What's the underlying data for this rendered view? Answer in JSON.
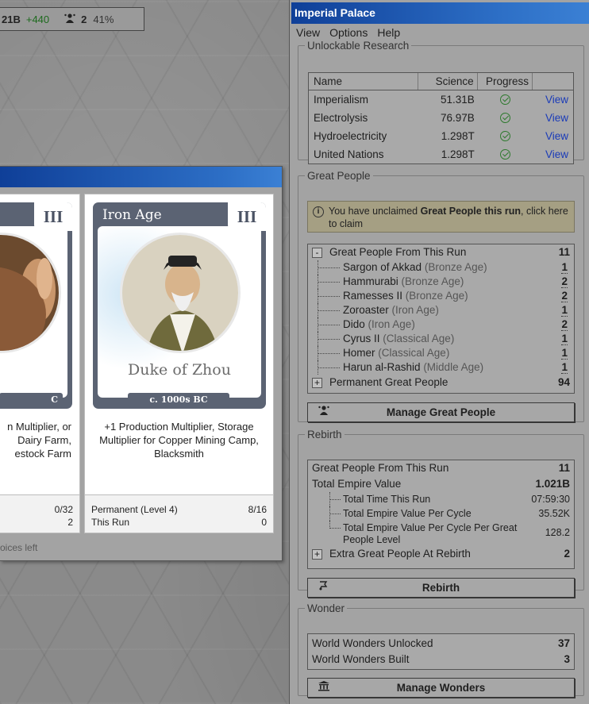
{
  "topbar": {
    "cash": "21B",
    "cash_gain": "+440",
    "great_people_icon": "great-person-icon",
    "great_people": "2",
    "percent": "41%"
  },
  "card": {
    "era": "Iron Age",
    "tier": "III",
    "name": "Duke of Zhou",
    "date": "c. 1000s BC",
    "description": "+1 Production Multiplier, Storage Multiplier for Copper Mining Camp, Blacksmith",
    "stats": {
      "permanent_label": "Permanent (Level 4)",
      "permanent_value": "8/16",
      "run_label": "This Run",
      "run_value": "0"
    }
  },
  "card_partial": {
    "tier": "III",
    "name_fragment": "",
    "date_fragment": "C",
    "description": "n Multiplier, or Dairy Farm, estock Farm",
    "stats_value1": "0/32",
    "stats_value2": "2"
  },
  "modal_footer": "oices left",
  "panel": {
    "title": "Imperial Palace",
    "menu": [
      "View",
      "Options",
      "Help"
    ],
    "research": {
      "legend": "Unlockable Research",
      "columns": [
        "Name",
        "Science",
        "Progress",
        ""
      ],
      "rows": [
        {
          "name": "Imperialism",
          "science": "51.31B",
          "view": "View"
        },
        {
          "name": "Electrolysis",
          "science": "76.97B",
          "view": "View"
        },
        {
          "name": "Hydroelectricity",
          "science": "1.298T",
          "view": "View"
        },
        {
          "name": "United Nations",
          "science": "1.298T",
          "view": "View"
        }
      ]
    },
    "great_people": {
      "legend": "Great People",
      "notice_prefix": "You have unclaimed ",
      "notice_bold": "Great People this run",
      "notice_suffix": ", click here to claim",
      "this_run_label": "Great People From This Run",
      "this_run_count": "11",
      "this_run_toggle": "-",
      "people": [
        {
          "name": "Sargon of Akkad",
          "era": "(Bronze Age)",
          "count": "1"
        },
        {
          "name": "Hammurabi",
          "era": "(Bronze Age)",
          "count": "2"
        },
        {
          "name": "Ramesses II",
          "era": "(Bronze Age)",
          "count": "2"
        },
        {
          "name": "Zoroaster",
          "era": "(Iron Age)",
          "count": "1"
        },
        {
          "name": "Dido",
          "era": "(Iron Age)",
          "count": "2"
        },
        {
          "name": "Cyrus II",
          "era": "(Classical Age)",
          "count": "1"
        },
        {
          "name": "Homer",
          "era": "(Classical Age)",
          "count": "1"
        },
        {
          "name": "Harun al-Rashid",
          "era": "(Middle Age)",
          "count": "1"
        }
      ],
      "permanent_label": "Permanent Great People",
      "permanent_count": "94",
      "permanent_toggle": "+",
      "manage_button": "Manage Great People"
    },
    "rebirth": {
      "legend": "Rebirth",
      "rows": {
        "gp_from_run_label": "Great People From This Run",
        "gp_from_run_value": "11",
        "empire_value_label": "Total Empire Value",
        "empire_value": "1.021B",
        "time_label": "Total Time This Run",
        "time_value": "07:59:30",
        "per_cycle_label": "Total Empire Value Per Cycle",
        "per_cycle_value": "35.52K",
        "per_cycle_gp_label": "Total Empire Value Per Cycle Per Great People Level",
        "per_cycle_gp_value": "128.2",
        "extra_label": "Extra Great People At Rebirth",
        "extra_value": "2",
        "extra_toggle": "+"
      },
      "button": "Rebirth"
    },
    "wonder": {
      "legend": "Wonder",
      "unlocked_label": "World Wonders Unlocked",
      "unlocked_value": "37",
      "built_label": "World Wonders Built",
      "built_value": "3",
      "button": "Manage Wonders"
    }
  },
  "colors": {
    "titlebar_start": "#0f3f98",
    "titlebar_end": "#3b80d4",
    "link": "#1a3bb8",
    "check": "#2f7a2f",
    "gain": "#1d6a1d",
    "card_frame": "#5b6373"
  }
}
